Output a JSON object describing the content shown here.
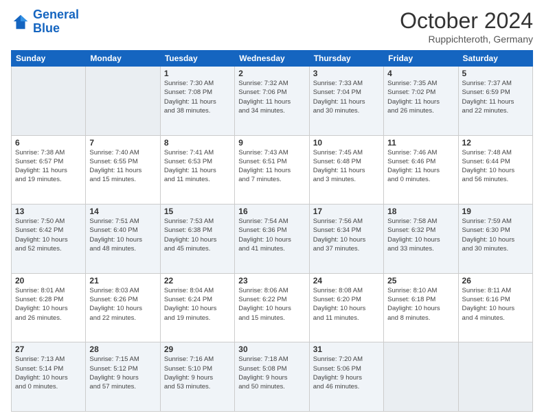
{
  "header": {
    "logo_line1": "General",
    "logo_line2": "Blue",
    "month_year": "October 2024",
    "location": "Ruppichteroth, Germany"
  },
  "weekdays": [
    "Sunday",
    "Monday",
    "Tuesday",
    "Wednesday",
    "Thursday",
    "Friday",
    "Saturday"
  ],
  "weeks": [
    [
      {
        "day": "",
        "detail": ""
      },
      {
        "day": "",
        "detail": ""
      },
      {
        "day": "1",
        "detail": "Sunrise: 7:30 AM\nSunset: 7:08 PM\nDaylight: 11 hours\nand 38 minutes."
      },
      {
        "day": "2",
        "detail": "Sunrise: 7:32 AM\nSunset: 7:06 PM\nDaylight: 11 hours\nand 34 minutes."
      },
      {
        "day": "3",
        "detail": "Sunrise: 7:33 AM\nSunset: 7:04 PM\nDaylight: 11 hours\nand 30 minutes."
      },
      {
        "day": "4",
        "detail": "Sunrise: 7:35 AM\nSunset: 7:02 PM\nDaylight: 11 hours\nand 26 minutes."
      },
      {
        "day": "5",
        "detail": "Sunrise: 7:37 AM\nSunset: 6:59 PM\nDaylight: 11 hours\nand 22 minutes."
      }
    ],
    [
      {
        "day": "6",
        "detail": "Sunrise: 7:38 AM\nSunset: 6:57 PM\nDaylight: 11 hours\nand 19 minutes."
      },
      {
        "day": "7",
        "detail": "Sunrise: 7:40 AM\nSunset: 6:55 PM\nDaylight: 11 hours\nand 15 minutes."
      },
      {
        "day": "8",
        "detail": "Sunrise: 7:41 AM\nSunset: 6:53 PM\nDaylight: 11 hours\nand 11 minutes."
      },
      {
        "day": "9",
        "detail": "Sunrise: 7:43 AM\nSunset: 6:51 PM\nDaylight: 11 hours\nand 7 minutes."
      },
      {
        "day": "10",
        "detail": "Sunrise: 7:45 AM\nSunset: 6:48 PM\nDaylight: 11 hours\nand 3 minutes."
      },
      {
        "day": "11",
        "detail": "Sunrise: 7:46 AM\nSunset: 6:46 PM\nDaylight: 11 hours\nand 0 minutes."
      },
      {
        "day": "12",
        "detail": "Sunrise: 7:48 AM\nSunset: 6:44 PM\nDaylight: 10 hours\nand 56 minutes."
      }
    ],
    [
      {
        "day": "13",
        "detail": "Sunrise: 7:50 AM\nSunset: 6:42 PM\nDaylight: 10 hours\nand 52 minutes."
      },
      {
        "day": "14",
        "detail": "Sunrise: 7:51 AM\nSunset: 6:40 PM\nDaylight: 10 hours\nand 48 minutes."
      },
      {
        "day": "15",
        "detail": "Sunrise: 7:53 AM\nSunset: 6:38 PM\nDaylight: 10 hours\nand 45 minutes."
      },
      {
        "day": "16",
        "detail": "Sunrise: 7:54 AM\nSunset: 6:36 PM\nDaylight: 10 hours\nand 41 minutes."
      },
      {
        "day": "17",
        "detail": "Sunrise: 7:56 AM\nSunset: 6:34 PM\nDaylight: 10 hours\nand 37 minutes."
      },
      {
        "day": "18",
        "detail": "Sunrise: 7:58 AM\nSunset: 6:32 PM\nDaylight: 10 hours\nand 33 minutes."
      },
      {
        "day": "19",
        "detail": "Sunrise: 7:59 AM\nSunset: 6:30 PM\nDaylight: 10 hours\nand 30 minutes."
      }
    ],
    [
      {
        "day": "20",
        "detail": "Sunrise: 8:01 AM\nSunset: 6:28 PM\nDaylight: 10 hours\nand 26 minutes."
      },
      {
        "day": "21",
        "detail": "Sunrise: 8:03 AM\nSunset: 6:26 PM\nDaylight: 10 hours\nand 22 minutes."
      },
      {
        "day": "22",
        "detail": "Sunrise: 8:04 AM\nSunset: 6:24 PM\nDaylight: 10 hours\nand 19 minutes."
      },
      {
        "day": "23",
        "detail": "Sunrise: 8:06 AM\nSunset: 6:22 PM\nDaylight: 10 hours\nand 15 minutes."
      },
      {
        "day": "24",
        "detail": "Sunrise: 8:08 AM\nSunset: 6:20 PM\nDaylight: 10 hours\nand 11 minutes."
      },
      {
        "day": "25",
        "detail": "Sunrise: 8:10 AM\nSunset: 6:18 PM\nDaylight: 10 hours\nand 8 minutes."
      },
      {
        "day": "26",
        "detail": "Sunrise: 8:11 AM\nSunset: 6:16 PM\nDaylight: 10 hours\nand 4 minutes."
      }
    ],
    [
      {
        "day": "27",
        "detail": "Sunrise: 7:13 AM\nSunset: 5:14 PM\nDaylight: 10 hours\nand 0 minutes."
      },
      {
        "day": "28",
        "detail": "Sunrise: 7:15 AM\nSunset: 5:12 PM\nDaylight: 9 hours\nand 57 minutes."
      },
      {
        "day": "29",
        "detail": "Sunrise: 7:16 AM\nSunset: 5:10 PM\nDaylight: 9 hours\nand 53 minutes."
      },
      {
        "day": "30",
        "detail": "Sunrise: 7:18 AM\nSunset: 5:08 PM\nDaylight: 9 hours\nand 50 minutes."
      },
      {
        "day": "31",
        "detail": "Sunrise: 7:20 AM\nSunset: 5:06 PM\nDaylight: 9 hours\nand 46 minutes."
      },
      {
        "day": "",
        "detail": ""
      },
      {
        "day": "",
        "detail": ""
      }
    ]
  ]
}
